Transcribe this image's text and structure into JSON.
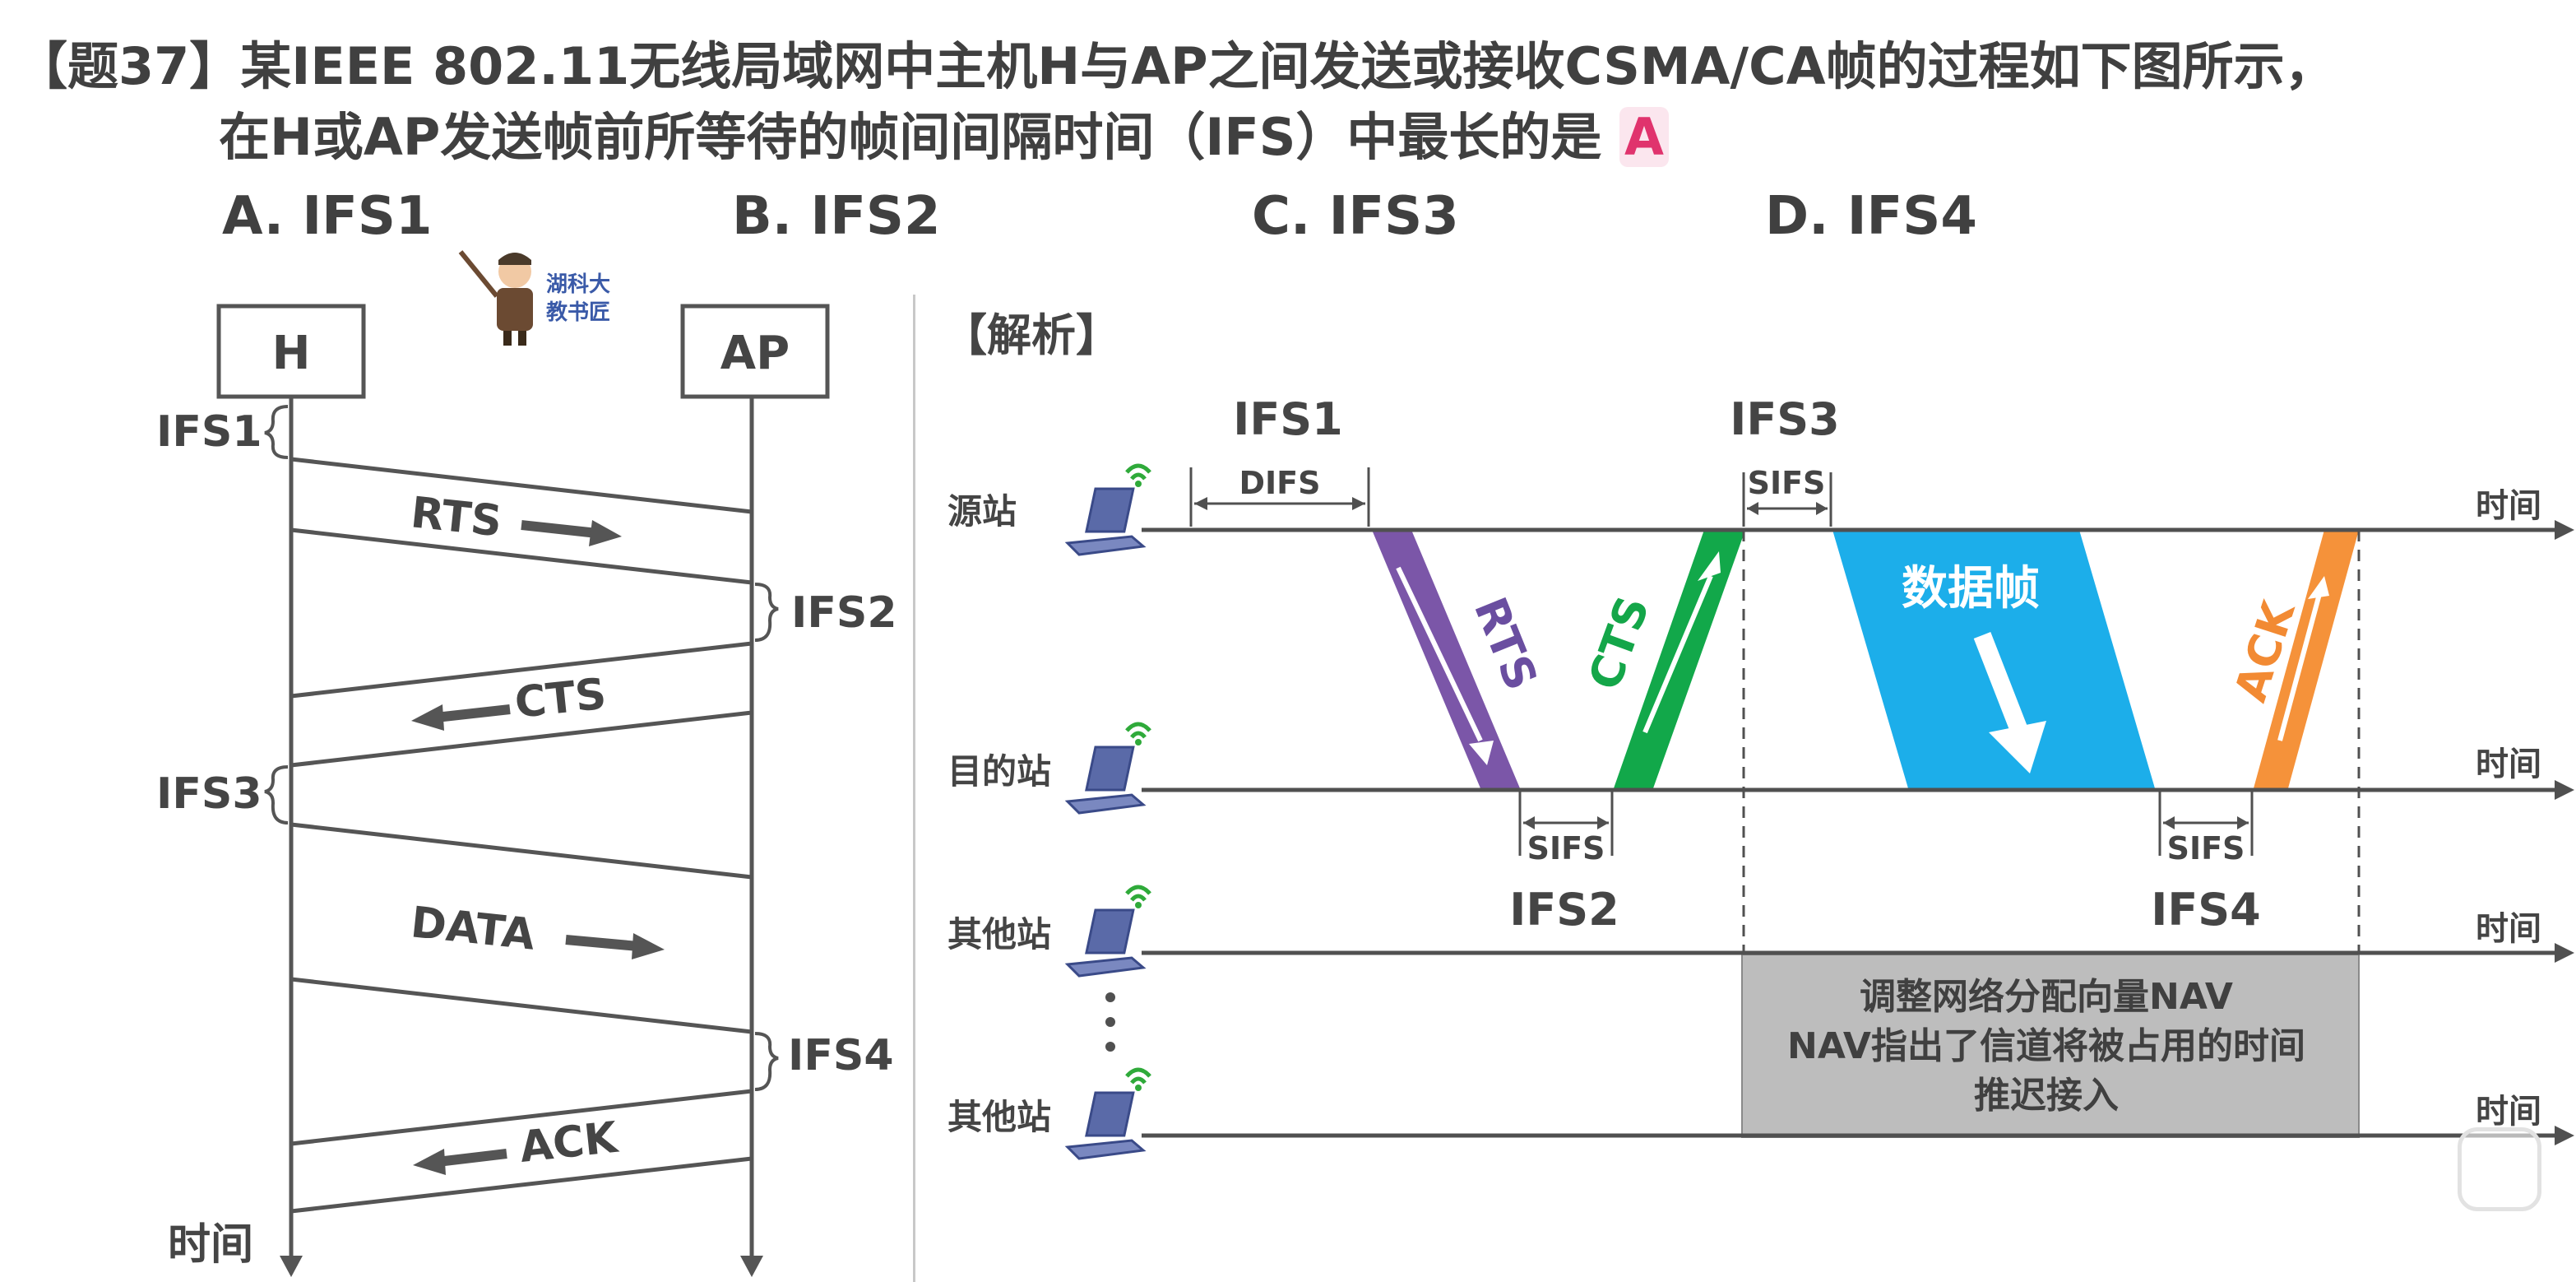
{
  "question": {
    "line1": "【题37】某IEEE 802.11无线局域网中主机H与AP之间发送或接收CSMA/CA帧的过程如下图所示，",
    "line2": "在H或AP发送帧前所等待的帧间间隔时间（IFS）中最长的是",
    "answer": "A"
  },
  "options": [
    "A. IFS1",
    "B. IFS2",
    "C. IFS3",
    "D. IFS4"
  ],
  "mascot_text": [
    "湖科大",
    "教书匠"
  ],
  "left_diagram": {
    "nodes": {
      "h": "H",
      "ap": "AP"
    },
    "ifs": {
      "ifs1": "IFS1",
      "ifs2": "IFS2",
      "ifs3": "IFS3",
      "ifs4": "IFS4"
    },
    "frames": {
      "rts": "RTS",
      "cts": "CTS",
      "data": "DATA",
      "ack": "ACK"
    },
    "time_label": "时间"
  },
  "right_diagram": {
    "heading": "【解析】",
    "stations": {
      "source": "源站",
      "dest": "目的站",
      "other1": "其他站",
      "other2": "其他站"
    },
    "time_label": "时间",
    "ifs": {
      "ifs1": "IFS1",
      "ifs2": "IFS2",
      "ifs3": "IFS3",
      "ifs4": "IFS4"
    },
    "intervals": {
      "difs": "DIFS",
      "sifs_a": "SIFS",
      "sifs_b": "SIFS",
      "sifs_c": "SIFS"
    },
    "frames": {
      "rts": "RTS",
      "cts": "CTS",
      "data": "数据帧",
      "ack": "ACK"
    },
    "nav": {
      "line1": "调整网络分配向量NAV",
      "line2": "NAV指出了信道将被占用的时间",
      "line3": "推迟接入"
    },
    "colors": {
      "rts": "#7b56a8",
      "cts": "#12a84a",
      "data": "#1caeea",
      "ack": "#f5923a",
      "nav": "#bdbdbd",
      "label_rts": "#6a4ea0",
      "label_cts": "#14a649",
      "label_ack": "#f28a33"
    }
  }
}
